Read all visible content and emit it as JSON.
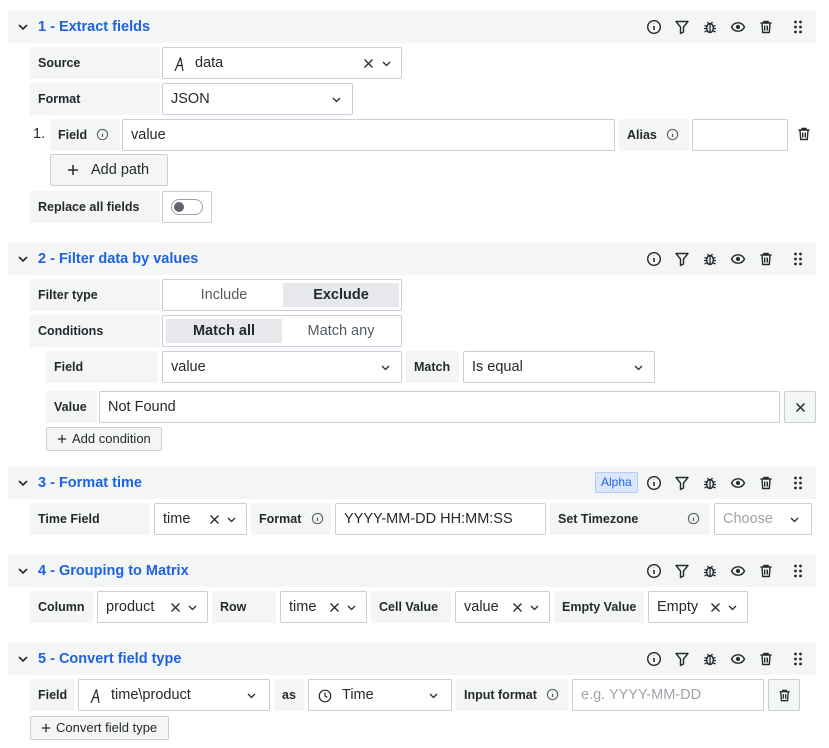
{
  "sections": [
    {
      "title": "1 - Extract fields"
    },
    {
      "title": "2 - Filter data by values"
    },
    {
      "title": "3 - Format time",
      "badge": "Alpha"
    },
    {
      "title": "4 - Grouping to Matrix"
    },
    {
      "title": "5 - Convert field type"
    }
  ],
  "s1": {
    "source_label": "Source",
    "source_value": "data",
    "format_label": "Format",
    "format_value": "JSON",
    "row_number": "1.",
    "field_label": "Field",
    "field_value": "value",
    "alias_label": "Alias",
    "alias_value": "",
    "add_path": "Add path",
    "replace_label": "Replace all fields"
  },
  "s2": {
    "filter_type_label": "Filter type",
    "include": "Include",
    "exclude": "Exclude",
    "conditions_label": "Conditions",
    "match_all": "Match all",
    "match_any": "Match any",
    "field_label": "Field",
    "field_value": "value",
    "match_label": "Match",
    "match_value": "Is equal",
    "value_label": "Value",
    "value_value": "Not Found",
    "add_condition": "Add condition"
  },
  "s3": {
    "time_field_label": "Time Field",
    "time_field_value": "time",
    "format_label": "Format",
    "format_value": "YYYY-MM-DD HH:MM:SS",
    "timezone_label": "Set Timezone",
    "timezone_value": "Choose"
  },
  "s4": {
    "column_label": "Column",
    "column_value": "product",
    "row_label": "Row",
    "row_value": "time",
    "cell_label": "Cell Value",
    "cell_value": "value",
    "empty_label": "Empty Value",
    "empty_value": "Empty"
  },
  "s5": {
    "field_label": "Field",
    "field_value": "time\\product",
    "as_label": "as",
    "type_value": "Time",
    "input_format_label": "Input format",
    "input_format_placeholder": "e.g. YYYY-MM-DD",
    "convert_button": "Convert field type"
  },
  "colors": {
    "accent": "#1f62e0",
    "label_bg": "#f4f5f5",
    "border": "#c7d0d9"
  }
}
